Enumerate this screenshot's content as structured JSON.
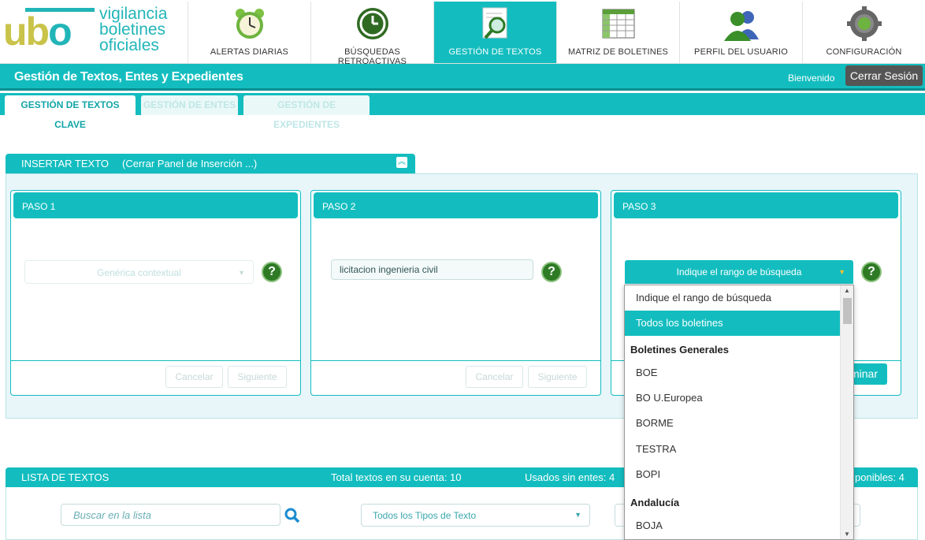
{
  "logo": {
    "mark_u": "u",
    "mark_b": "b",
    "mark_o": "o",
    "line1": "vigilancia",
    "line2": "boletines",
    "line3": "oficiales"
  },
  "nav": [
    {
      "label": "ALERTAS DIARIAS",
      "icon": "alarm-clock-icon"
    },
    {
      "label": "BÚSQUEDAS RETROACTIVAS",
      "icon": "history-icon"
    },
    {
      "label": "GESTIÓN DE TEXTOS",
      "icon": "magnifier-document-icon"
    },
    {
      "label": "MATRIZ DE BOLETINES",
      "icon": "spreadsheet-icon"
    },
    {
      "label": "PERFIL DEL USUARIO",
      "icon": "users-icon"
    },
    {
      "label": "CONFIGURACIÓN",
      "icon": "gear-icon"
    }
  ],
  "title_bar": {
    "title": "Gestión de Textos, Entes y Expedientes",
    "welcome": "Bienvenido",
    "logout": "Cerrar Sesión"
  },
  "subtabs": [
    "GESTIÓN DE TEXTOS CLAVE",
    "GESTIÓN DE ENTES",
    "GESTIÓN DE EXPEDIENTES"
  ],
  "insert_panel": {
    "title": "INSERTAR TEXTO",
    "close_link": "(Cerrar Panel de Inserción ...)"
  },
  "steps": {
    "step1": {
      "title": "PASO 1",
      "select_value": "Genérica contextual",
      "cancel": "Cancelar",
      "next": "Siguiente"
    },
    "step2": {
      "title": "PASO 2",
      "input_value": "licitacion ingenieria civil",
      "cancel": "Cancelar",
      "next": "Siguiente"
    },
    "step3": {
      "title": "PASO 3",
      "select_value": "Indique el rango de búsqueda",
      "delete_partial": "minar"
    }
  },
  "help_label": "?",
  "dropdown": {
    "items": [
      {
        "type": "option",
        "label": "Indique el rango de búsqueda"
      },
      {
        "type": "option",
        "label": "Todos los boletines",
        "selected": true
      },
      {
        "type": "group",
        "label": "Boletines Generales"
      },
      {
        "type": "option",
        "label": "BOE"
      },
      {
        "type": "option",
        "label": "BO U.Europea"
      },
      {
        "type": "option",
        "label": "BORME"
      },
      {
        "type": "option",
        "label": "TESTRA"
      },
      {
        "type": "option",
        "label": "BOPI"
      },
      {
        "type": "group",
        "label": "Andalucía"
      },
      {
        "type": "option",
        "label": "BOJA"
      }
    ]
  },
  "list": {
    "title": "LISTA DE TEXTOS",
    "total": "Total textos en su cuenta: 10",
    "used": "Usados sin entes: 4",
    "available": "ponibles: 4",
    "search_placeholder": "Buscar en la lista",
    "type_filter": "Todos los Tipos de Texto"
  },
  "colors": {
    "accent": "#13bdbf",
    "dark_accent": "#0b8f91",
    "logo_yellow": "#c9c34a",
    "help_green": "#2e7a25"
  }
}
